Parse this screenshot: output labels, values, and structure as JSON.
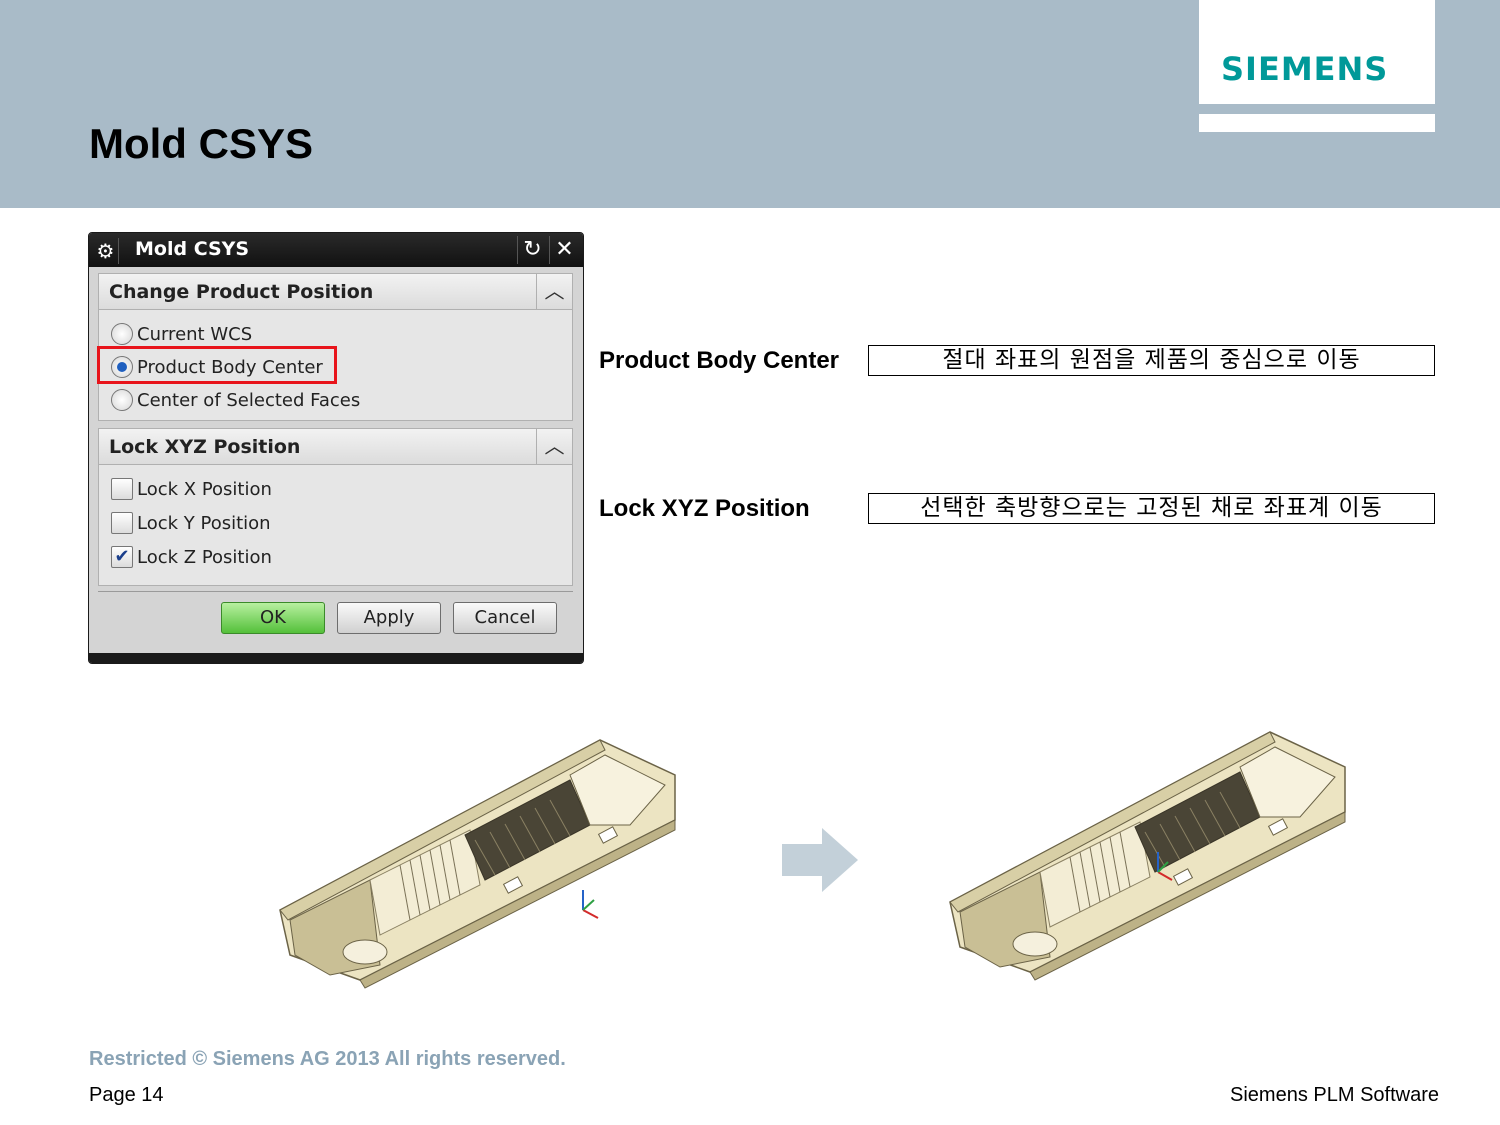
{
  "slide": {
    "title": "Mold CSYS",
    "logo": "SIEMENS"
  },
  "dialog": {
    "title": "Mold CSYS",
    "icons": {
      "settings": "gear-icon",
      "reset": "reset-icon",
      "close": "close-icon",
      "collapse": "chevron-up-icon"
    },
    "group1": {
      "label": "Change Product Position",
      "options": [
        {
          "label": "Current WCS",
          "selected": false
        },
        {
          "label": "Product Body Center",
          "selected": true
        },
        {
          "label": "Center of Selected Faces",
          "selected": false
        }
      ]
    },
    "group2": {
      "label": "Lock XYZ Position",
      "options": [
        {
          "label": "Lock X Position",
          "checked": false
        },
        {
          "label": "Lock Y Position",
          "checked": false
        },
        {
          "label": "Lock Z Position",
          "checked": true
        }
      ]
    },
    "buttons": {
      "ok": "OK",
      "apply": "Apply",
      "cancel": "Cancel"
    }
  },
  "annotations": [
    {
      "label": "Product Body Center",
      "description": "절대 좌표의 원점을 제품의 중심으로 이동"
    },
    {
      "label": "Lock XYZ Position",
      "description": "선택한 축방향으로는 고정된 채로 좌표계 이동"
    }
  ],
  "colors": {
    "header_band": "#a9bbc8",
    "logo": "#009999",
    "highlight": "#e8141b",
    "ok_button": "#54c03a",
    "part_body": "#ece4c2",
    "arrow": "#c3d0d9"
  },
  "footer": {
    "restricted": "Restricted © Siemens AG 2013 All rights reserved.",
    "page": "Page 14",
    "company": "Siemens PLM Software"
  }
}
